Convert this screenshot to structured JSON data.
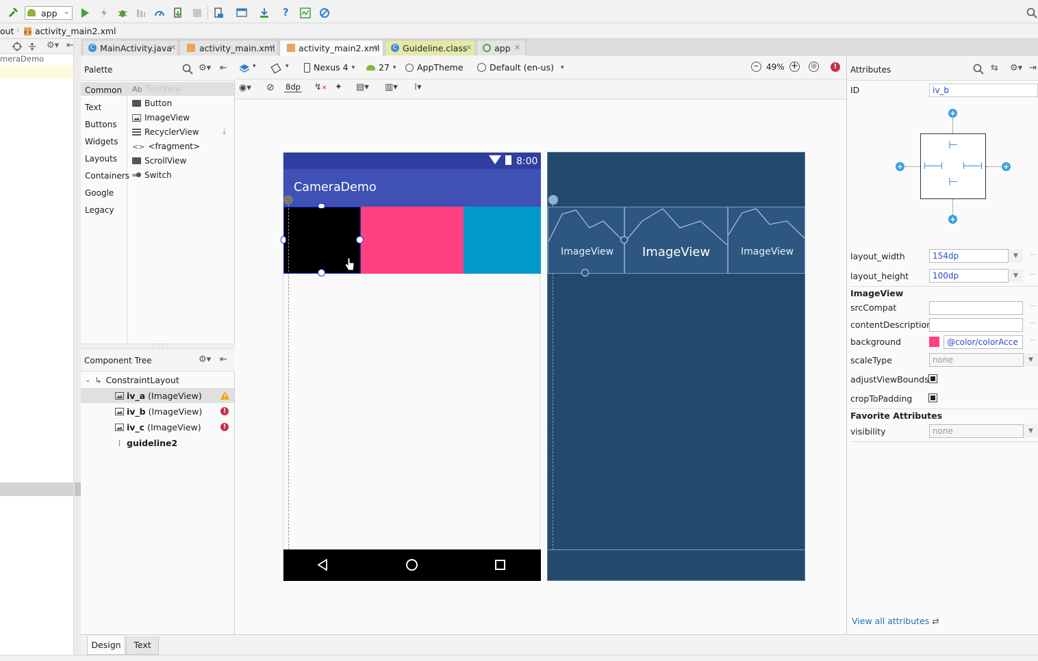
{
  "toolbar": {
    "run_config": "app"
  },
  "breadcrumb": {
    "prev": "out",
    "file": "activity_main2.xml"
  },
  "project_panel": {
    "item": "meraDemo"
  },
  "tabs": [
    {
      "label": "MainActivity.java"
    },
    {
      "label": "activity_main.xml"
    },
    {
      "label": "activity_main2.xml"
    },
    {
      "label": "Guideline.class"
    },
    {
      "label": "app"
    }
  ],
  "palette": {
    "title": "Palette",
    "categories": [
      "Common",
      "Text",
      "Buttons",
      "Widgets",
      "Layouts",
      "Containers",
      "Google",
      "Legacy"
    ],
    "items": [
      "TextView",
      "Button",
      "ImageView",
      "RecyclerView",
      "<fragment>",
      "ScrollView",
      "Switch"
    ],
    "textview_prefix": "Ab"
  },
  "editor_toolbar": {
    "device": "Nexus 4",
    "api": "27",
    "theme": "AppTheme",
    "locale": "Default (en-us)",
    "zoom": "49%",
    "margin": "8dp"
  },
  "device_preview": {
    "time": "8:00",
    "app_title": "CameraDemo"
  },
  "blueprint": {
    "labels": [
      "ImageView",
      "ImageView",
      "ImageView"
    ]
  },
  "component_tree": {
    "title": "Component Tree",
    "root": "ConstraintLayout",
    "rows": [
      {
        "id": "iv_a",
        "type": "(ImageView)",
        "status": "warning"
      },
      {
        "id": "iv_b",
        "type": "(ImageView)",
        "status": "error"
      },
      {
        "id": "iv_c",
        "type": "(ImageView)",
        "status": "error"
      },
      {
        "id": "guideline2",
        "type": "",
        "status": "none"
      }
    ]
  },
  "attributes": {
    "title": "Attributes",
    "id_label": "ID",
    "id_value": "iv_b",
    "layout_width_label": "layout_width",
    "layout_width": "154dp",
    "layout_height_label": "layout_height",
    "layout_height": "100dp",
    "section_imageview": "ImageView",
    "srcCompat_label": "srcCompat",
    "srcCompat": "",
    "contentDescription_label": "contentDescription",
    "contentDescription": "",
    "background_label": "background",
    "background": "@color/colorAcce",
    "background_color": "#ff4081",
    "scaleType_label": "scaleType",
    "scaleType": "none",
    "adjustViewBounds_label": "adjustViewBounds",
    "cropToPadding_label": "cropToPadding",
    "section_favorite": "Favorite Attributes",
    "visibility_label": "visibility",
    "visibility": "none",
    "view_all": "View all attributes"
  },
  "bottom_tabs": {
    "design": "Design",
    "text": "Text"
  },
  "colors": {
    "primary": "#3f51b5",
    "primary_dark": "#303f9f",
    "accent": "#ff4081",
    "cyan": "#0099cc",
    "blueprint": "#234a6e",
    "error": "#c9304a",
    "warning": "#f0a30a",
    "link": "#2470b3"
  }
}
